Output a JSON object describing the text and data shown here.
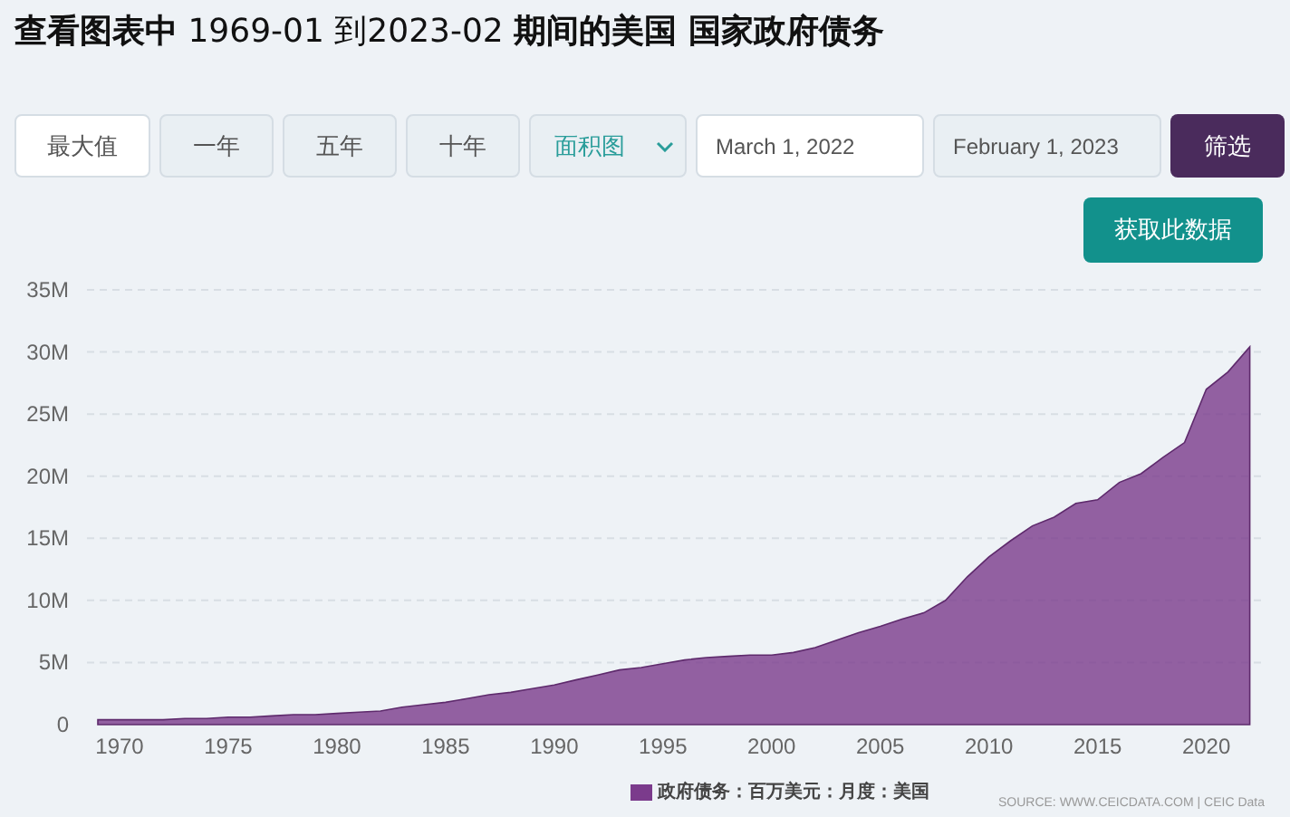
{
  "title": {
    "bold_prefix": "查看图表中",
    "range": "1969-01 到2023-02",
    "bold_suffix": "期间的美国 国家政府债务"
  },
  "range_buttons": [
    {
      "label": "最大值",
      "selected": true
    },
    {
      "label": "一年",
      "selected": false
    },
    {
      "label": "五年",
      "selected": false
    },
    {
      "label": "十年",
      "selected": false
    }
  ],
  "chart_type": {
    "value": "面积图"
  },
  "date_from": {
    "value": "March 1, 2022"
  },
  "date_to": {
    "value": "February 1, 2023"
  },
  "filter_button": "筛选",
  "fetch_button": "获取此数据",
  "chart_data": {
    "type": "area",
    "x": [
      1969,
      1970,
      1971,
      1972,
      1973,
      1974,
      1975,
      1976,
      1977,
      1978,
      1979,
      1980,
      1981,
      1982,
      1983,
      1984,
      1985,
      1986,
      1987,
      1988,
      1989,
      1990,
      1991,
      1992,
      1993,
      1994,
      1995,
      1996,
      1997,
      1998,
      1999,
      2000,
      2001,
      2002,
      2003,
      2004,
      2005,
      2006,
      2007,
      2008,
      2009,
      2010,
      2011,
      2012,
      2013,
      2014,
      2015,
      2016,
      2017,
      2018,
      2019,
      2020,
      2021,
      2022
    ],
    "series": [
      {
        "name": "政府债务：百万美元：月度：美国",
        "color": "#7b3b8c",
        "values": [
          0.4,
          0.4,
          0.4,
          0.4,
          0.5,
          0.5,
          0.6,
          0.6,
          0.7,
          0.8,
          0.8,
          0.9,
          1.0,
          1.1,
          1.4,
          1.6,
          1.8,
          2.1,
          2.4,
          2.6,
          2.9,
          3.2,
          3.6,
          4.0,
          4.4,
          4.6,
          4.9,
          5.2,
          5.4,
          5.5,
          5.6,
          5.6,
          5.8,
          6.2,
          6.8,
          7.4,
          7.9,
          8.5,
          9.0,
          10.0,
          11.9,
          13.5,
          14.8,
          16.0,
          16.7,
          17.8,
          18.1,
          19.5,
          20.2,
          21.5,
          22.7,
          27.0,
          28.4,
          30.4
        ]
      }
    ],
    "xlim": [
      1968.5,
      2022.6
    ],
    "ylim": [
      0,
      35
    ],
    "grid": true,
    "xticks": [
      1970,
      1975,
      1980,
      1985,
      1990,
      1995,
      2000,
      2005,
      2010,
      2015,
      2020
    ],
    "yticks": [
      {
        "value": 0,
        "label": "0"
      },
      {
        "value": 5,
        "label": "5M"
      },
      {
        "value": 10,
        "label": "10M"
      },
      {
        "value": 15,
        "label": "15M"
      },
      {
        "value": 20,
        "label": "20M"
      },
      {
        "value": 25,
        "label": "25M"
      },
      {
        "value": 30,
        "label": "30M"
      },
      {
        "value": 35,
        "label": "35M"
      }
    ]
  },
  "source": "SOURCE: WWW.CEICDATA.COM | CEIC Data"
}
